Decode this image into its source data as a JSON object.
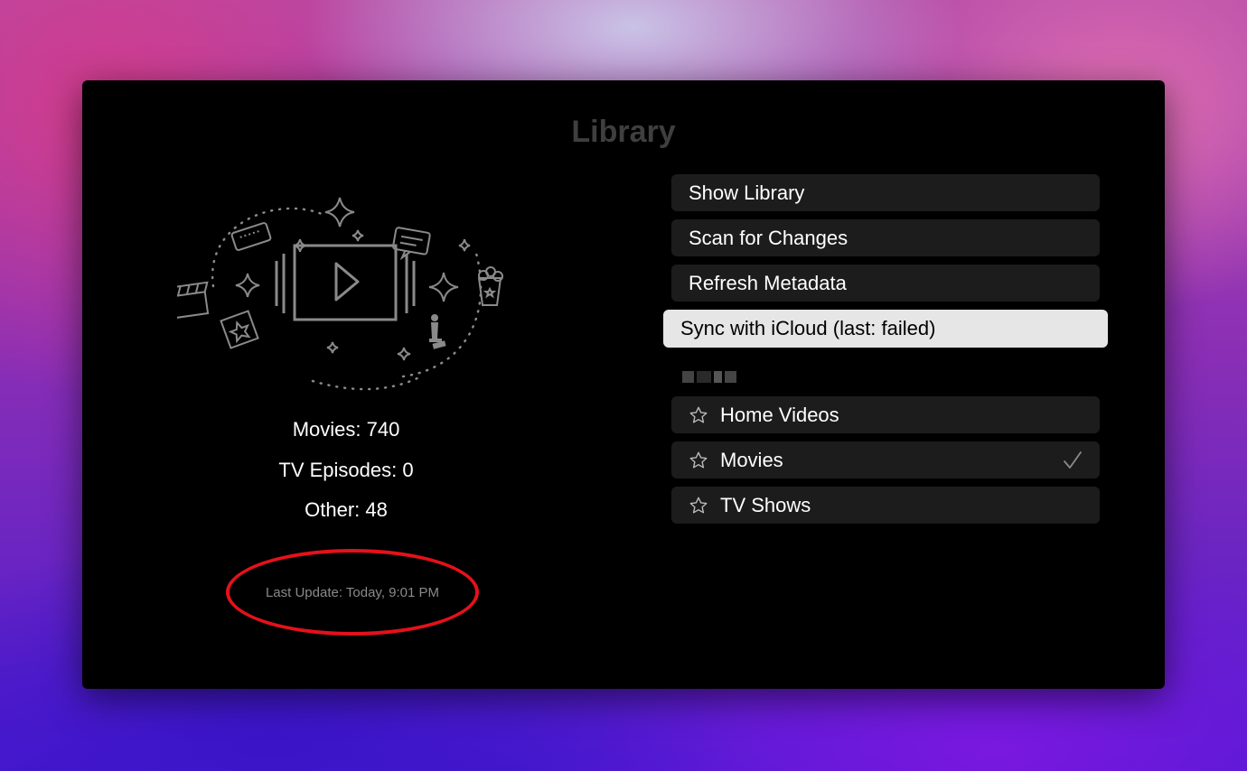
{
  "window": {
    "title": "Library"
  },
  "stats": {
    "movies": "Movies: 740",
    "tv_episodes": "TV Episodes: 0",
    "other": "Other: 48",
    "last_update": "Last Update: Today, 9:01 PM"
  },
  "actions": [
    {
      "label": "Show Library"
    },
    {
      "label": "Scan for Changes"
    },
    {
      "label": "Refresh Metadata"
    },
    {
      "label": "Sync with iCloud (last: failed)",
      "focused": true
    }
  ],
  "collections": [
    {
      "label": "Home Videos",
      "icon": "star-icon",
      "checked": false
    },
    {
      "label": "Movies",
      "icon": "star-icon",
      "checked": true
    },
    {
      "label": "TV Shows",
      "icon": "star-icon",
      "checked": false
    }
  ],
  "colors": {
    "highlight_ring": "#e5111a",
    "focused_item_bg": "#e6e6e6",
    "item_bg": "#1c1c1c"
  }
}
